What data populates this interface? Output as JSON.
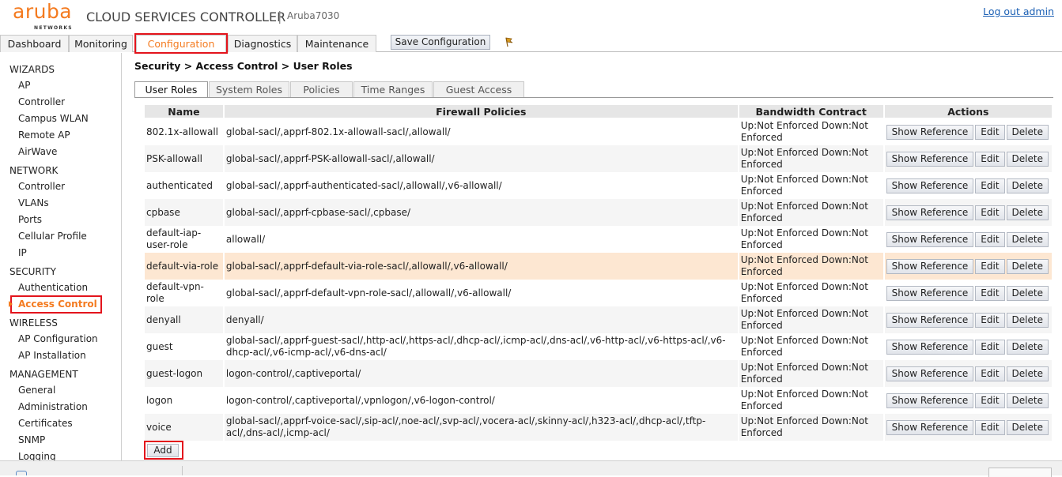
{
  "header": {
    "logo_word": "aruba",
    "logo_sub": "NETWORKS",
    "app_title": "CLOUD SERVICES CONTROLLER",
    "separator": "|",
    "device": "Aruba7030",
    "logout": "Log out admin"
  },
  "main_tabs": [
    {
      "label": "Dashboard"
    },
    {
      "label": "Monitoring"
    },
    {
      "label": "Configuration",
      "active": true
    },
    {
      "label": "Diagnostics"
    },
    {
      "label": "Maintenance"
    }
  ],
  "save_config": "Save Configuration",
  "sidebar": {
    "sections": [
      {
        "title": "WIZARDS",
        "items": [
          "AP",
          "Controller",
          "Campus WLAN",
          "Remote AP",
          "AirWave"
        ]
      },
      {
        "title": "NETWORK",
        "items": [
          "Controller",
          "VLANs",
          "Ports",
          "Cellular Profile",
          "IP"
        ]
      },
      {
        "title": "SECURITY",
        "items": [
          "Authentication",
          "Access Control"
        ]
      },
      {
        "title": "WIRELESS",
        "items": [
          "AP Configuration",
          "AP Installation"
        ]
      },
      {
        "title": "MANAGEMENT",
        "items": [
          "General",
          "Administration",
          "Certificates",
          "SNMP",
          "Logging"
        ]
      }
    ],
    "active_item": "Access Control"
  },
  "breadcrumb": "Security > Access Control > User Roles",
  "sub_tabs": [
    {
      "label": "User Roles",
      "active": true
    },
    {
      "label": "System Roles"
    },
    {
      "label": "Policies"
    },
    {
      "label": "Time Ranges"
    },
    {
      "label": "Guest Access"
    }
  ],
  "table": {
    "headers": [
      "Name",
      "Firewall Policies",
      "Bandwidth Contract",
      "Actions"
    ],
    "buttons": {
      "show_reference": "Show Reference",
      "edit": "Edit",
      "delete": "Delete"
    },
    "rows": [
      {
        "name": "802.1x-allowall",
        "policies": "global-sacl/,apprf-802.1x-allowall-sacl/,allowall/",
        "bandwidth": "Up:Not Enforced  Down:Not Enforced"
      },
      {
        "name": "PSK-allowall",
        "policies": "global-sacl/,apprf-PSK-allowall-sacl/,allowall/",
        "bandwidth": "Up:Not Enforced  Down:Not Enforced"
      },
      {
        "name": "authenticated",
        "policies": "global-sacl/,apprf-authenticated-sacl/,allowall/,v6-allowall/",
        "bandwidth": "Up:Not Enforced  Down:Not Enforced"
      },
      {
        "name": "cpbase",
        "policies": "global-sacl/,apprf-cpbase-sacl/,cpbase/",
        "bandwidth": "Up:Not Enforced  Down:Not Enforced"
      },
      {
        "name": "default-iap-user-role",
        "policies": "allowall/",
        "bandwidth": "Up:Not Enforced  Down:Not Enforced"
      },
      {
        "name": "default-via-role",
        "policies": "global-sacl/,apprf-default-via-role-sacl/,allowall/,v6-allowall/",
        "bandwidth": "Up:Not Enforced  Down:Not Enforced",
        "highlight": true
      },
      {
        "name": "default-vpn-role",
        "policies": "global-sacl/,apprf-default-vpn-role-sacl/,allowall/,v6-allowall/",
        "bandwidth": "Up:Not Enforced  Down:Not Enforced"
      },
      {
        "name": "denyall",
        "policies": "denyall/",
        "bandwidth": "Up:Not Enforced  Down:Not Enforced"
      },
      {
        "name": "guest",
        "policies": "global-sacl/,apprf-guest-sacl/,http-acl/,https-acl/,dhcp-acl/,icmp-acl/,dns-acl/,v6-http-acl/,v6-https-acl/,v6-dhcp-acl/,v6-icmp-acl/,v6-dns-acl/",
        "bandwidth": "Up:Not Enforced  Down:Not Enforced"
      },
      {
        "name": "guest-logon",
        "policies": "logon-control/,captiveportal/",
        "bandwidth": "Up:Not Enforced  Down:Not Enforced"
      },
      {
        "name": "logon",
        "policies": "logon-control/,captiveportal/,vpnlogon/,v6-logon-control/",
        "bandwidth": "Up:Not Enforced  Down:Not Enforced"
      },
      {
        "name": "voice",
        "policies": "global-sacl/,apprf-voice-sacl/,sip-acl/,noe-acl/,svp-acl/,vocera-acl/,skinny-acl/,h323-acl/,dhcp-acl/,tftp-acl/,dns-acl/,icmp-acl/",
        "bandwidth": "Up:Not Enforced  Down:Not Enforced"
      }
    ]
  },
  "add_button": "Add",
  "colors": {
    "accent": "#f47b20",
    "highlight_box": "#e3141c",
    "link": "#1a5fb4",
    "row_highlight": "#fde7d2"
  }
}
